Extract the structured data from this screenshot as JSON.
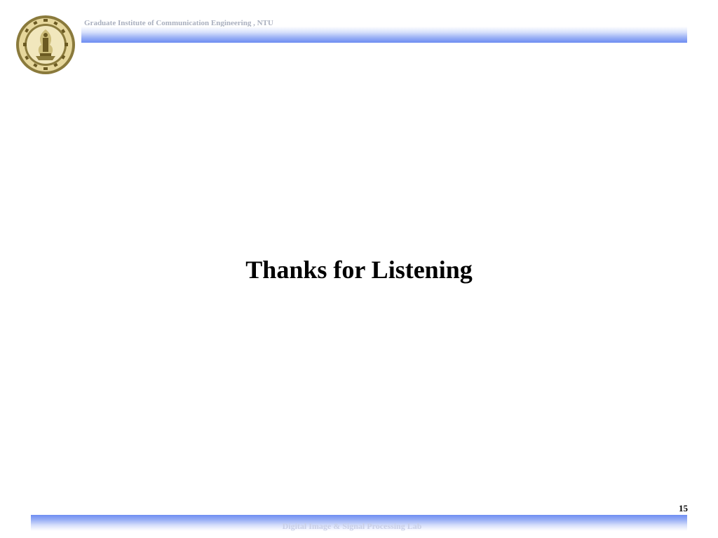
{
  "header": {
    "institute": "Graduate Institute of Communication Engineering , NTU"
  },
  "main": {
    "title": "Thanks for Listening"
  },
  "footer": {
    "lab": "Digital Image & Signal Processing Lab",
    "page_number": "15"
  },
  "logo": {
    "icon": "ntu-emblem-icon",
    "outer_color": "#8a7a3c",
    "inner_color": "#e9dcaa"
  },
  "colors": {
    "bar_blue": "#6e8df2",
    "header_text": "#aab0bf",
    "footer_text": "#c9cfe6"
  }
}
